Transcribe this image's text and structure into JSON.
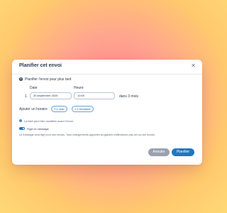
{
  "dialog": {
    "title": "Planifier cet envoi",
    "close_glyph": "✕"
  },
  "schedule": {
    "option_label": "Planifier l'envoi pour plus tard",
    "date_label": "Date",
    "time_label": "Heure",
    "row_index": "1",
    "date_value": "30 septembre 2025",
    "time_value": "10:00",
    "relative_text": "dans 3 mois"
  },
  "add_time": {
    "label": "Ajouter un horaire",
    "chip_1_label": "+ 1 Jour",
    "chip_2_label": "+ 1 Semaine"
  },
  "notes": {
    "info_text": "La liste peut être modifiée avant l'envoi.",
    "pin_label": "Figer le message",
    "pin_enabled": true,
    "pin_description": "Le message sera figé pour ses envois. Tous changements apportés au gabarit n'affecteront pas cet ou ces envois"
  },
  "footer": {
    "cancel_label": "Annuler",
    "submit_label": "Planifier"
  },
  "colors": {
    "accent": "#1f78c1",
    "cancel": "#9aa2ae",
    "text": "#2e3a4e"
  },
  "icons": {
    "close": "close-icon",
    "schedule": "clock-icon",
    "info": "info-icon",
    "pin": "toggle-switch"
  }
}
